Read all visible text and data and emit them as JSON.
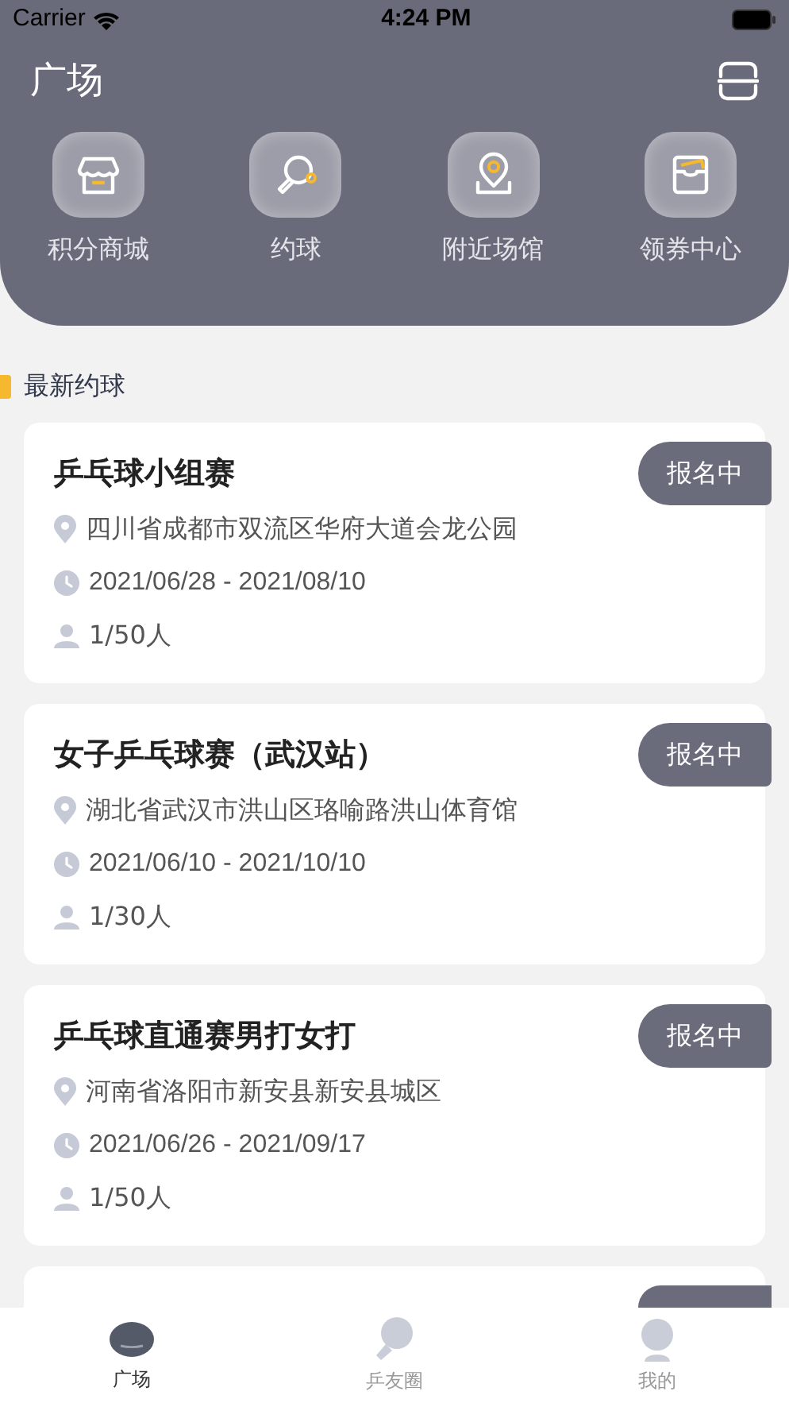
{
  "status_bar": {
    "carrier": "Carrier",
    "time": "4:24 PM"
  },
  "header": {
    "title": "广场"
  },
  "shortcuts": [
    {
      "label": "积分商城",
      "kind": "shop"
    },
    {
      "label": "约球",
      "kind": "paddle"
    },
    {
      "label": "附近场馆",
      "kind": "location"
    },
    {
      "label": "领券中心",
      "kind": "coupon"
    }
  ],
  "section": {
    "title": "最新约球"
  },
  "matches": [
    {
      "title": "乒乓球小组赛",
      "status": "报名中",
      "address": "四川省成都市双流区华府大道会龙公园",
      "dates": "2021/06/28 - 2021/08/10",
      "people": "1/50人"
    },
    {
      "title": "女子乒乓球赛（武汉站）",
      "status": "报名中",
      "address": "湖北省武汉市洪山区珞喻路洪山体育馆",
      "dates": "2021/06/10 - 2021/10/10",
      "people": "1/30人"
    },
    {
      "title": "乒乓球直通赛男打女打",
      "status": "报名中",
      "address": "河南省洛阳市新安县新安县城区",
      "dates": "2021/06/26 - 2021/09/17",
      "people": "1/50人"
    }
  ],
  "tab_bar": [
    {
      "label": "广场",
      "selected": true,
      "kind": "planet"
    },
    {
      "label": "乒友圈",
      "selected": false,
      "kind": "paddle"
    },
    {
      "label": "我的",
      "selected": false,
      "kind": "person"
    }
  ]
}
